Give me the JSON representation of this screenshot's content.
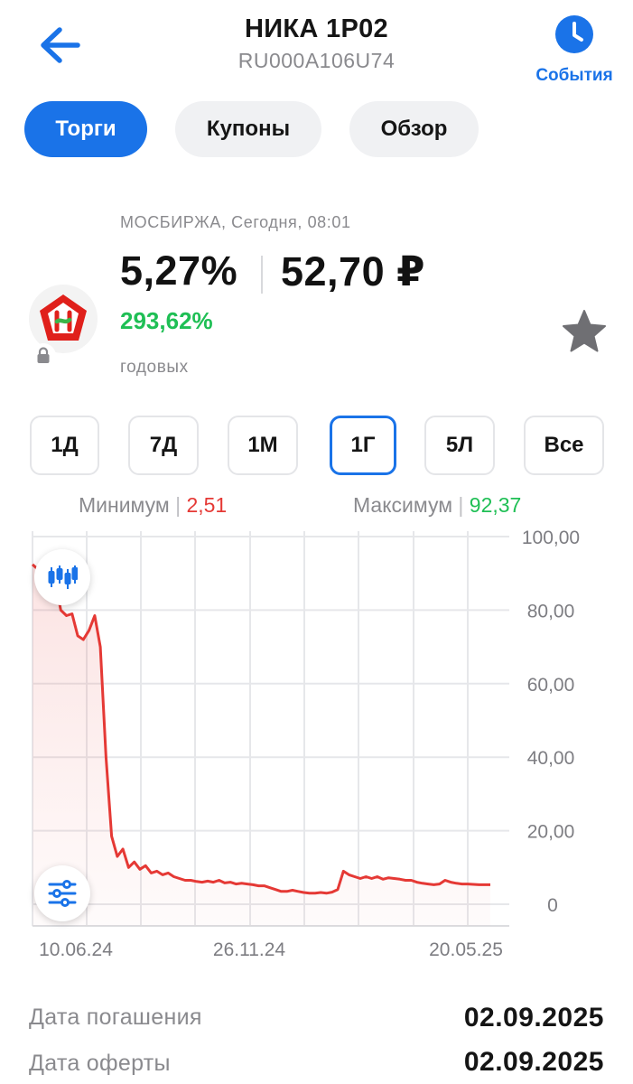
{
  "header": {
    "back_icon": "arrow-left-icon",
    "title": "НИКА 1Р02",
    "isin": "RU000A106U74",
    "events_label": "События",
    "events_icon": "clock-icon"
  },
  "tabs": [
    {
      "label": "Торги",
      "active": true
    },
    {
      "label": "Купоны",
      "active": false
    },
    {
      "label": "Обзор",
      "active": false
    }
  ],
  "quote": {
    "exchange_time": "МОСБИРЖА, Сегодня, 08:01",
    "yield": "5,27%",
    "price": "52,70 ₽",
    "annual_yield": "293,62%",
    "annual_label": "годовых",
    "issuer_logo_letter": "Н"
  },
  "periods": [
    {
      "label": "1Д",
      "selected": false
    },
    {
      "label": "7Д",
      "selected": false
    },
    {
      "label": "1М",
      "selected": false
    },
    {
      "label": "1Г",
      "selected": true
    },
    {
      "label": "5Л",
      "selected": false
    },
    {
      "label": "Все",
      "selected": false
    }
  ],
  "range": {
    "min_label": "Минимум",
    "min_value": "2,51",
    "max_label": "Максимум",
    "max_value": "92,37"
  },
  "chart_data": {
    "type": "area",
    "y_ticks": [
      "100,00",
      "80,00",
      "60,00",
      "40,00",
      "20,00",
      "0"
    ],
    "x_ticks": [
      "10.06.24",
      "26.11.24",
      "20.05.25"
    ],
    "ylim": [
      0,
      100
    ],
    "line_color": "#e53935",
    "series": [
      {
        "values": [
          92.4,
          91.0,
          90.5,
          90.0,
          88.0,
          80.0,
          78.5,
          79.0,
          73.0,
          72.0,
          74.5,
          78.5,
          70.0,
          40.0,
          18.5,
          13.0,
          15.0,
          10.0,
          11.5,
          9.5,
          10.5,
          8.5,
          9.0,
          8.0,
          8.5,
          7.5,
          7.0,
          6.5,
          6.5,
          6.2,
          6.0,
          6.3,
          6.0,
          6.5,
          5.8,
          6.0,
          5.5,
          5.7,
          5.5,
          5.3,
          5.0,
          5.0,
          4.5,
          4.0,
          3.5,
          3.5,
          3.8,
          3.5,
          3.2,
          3.0,
          3.0,
          3.2,
          3.0,
          3.3,
          4.0,
          9.0,
          8.0,
          7.5,
          7.0,
          7.5,
          7.0,
          7.5,
          6.8,
          7.2,
          7.0,
          6.8,
          6.5,
          6.5,
          6.0,
          5.7,
          5.5,
          5.3,
          5.5,
          6.5,
          6.0,
          5.7,
          5.5,
          5.5,
          5.4,
          5.3,
          5.3,
          5.3
        ]
      }
    ]
  },
  "chart_controls": {
    "candles_icon": "candlestick-icon",
    "settings_icon": "sliders-icon"
  },
  "details": [
    {
      "label": "Дата погашения",
      "value": "02.09.2025"
    },
    {
      "label": "Дата оферты",
      "value": "02.09.2025"
    }
  ]
}
